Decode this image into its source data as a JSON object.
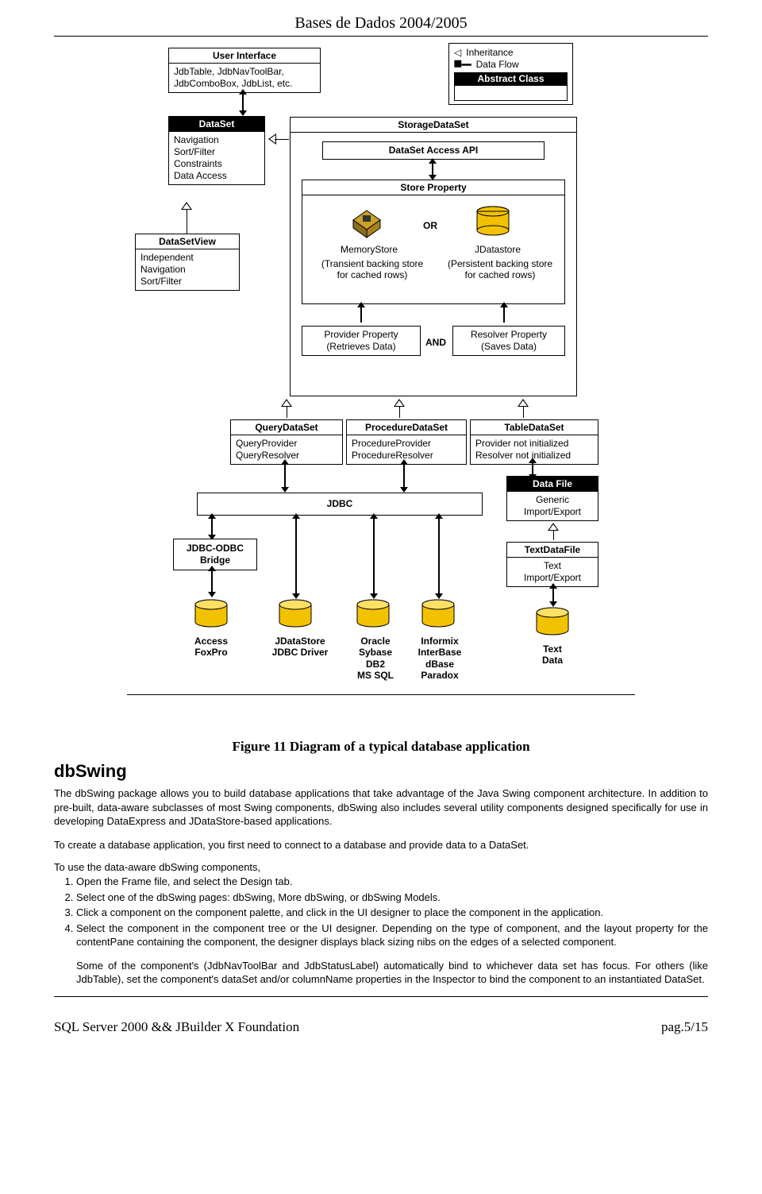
{
  "header": {
    "title": "Bases de Dados 2004/2005"
  },
  "diagram": {
    "legend": {
      "inheritance": "Inheritance",
      "dataflow": "Data Flow",
      "abstract": "Abstract Class"
    },
    "ui": {
      "title": "User Interface",
      "body": "JdbTable, JdbNavToolBar, JdbComboBox, JdbList, etc."
    },
    "dataset": {
      "title": "DataSet",
      "body": "Navigation\nSort/Filter\nConstraints\nData Access"
    },
    "datasetview": {
      "title": "DataSetView",
      "body": "Independent\nNavigation\nSort/Filter"
    },
    "storage": {
      "title": "StorageDataSet",
      "api": "DataSet Access API",
      "store_prop": "Store Property",
      "or": "OR",
      "mem_label": "MemoryStore",
      "mem_desc": "Transient backing store\nfor cached rows",
      "jds_label": "JDatastore",
      "jds_desc": "Persistent backing store\nfor cached rows",
      "provider": "Provider Property\n(Retrieves Data)",
      "and": "AND",
      "resolver": "Resolver Property\n(Saves Data)"
    },
    "query": {
      "title": "QueryDataSet",
      "body": "QueryProvider\nQueryResolver"
    },
    "proc": {
      "title": "ProcedureDataSet",
      "body": "ProcedureProvider\nProcedureResolver"
    },
    "table": {
      "title": "TableDataSet",
      "body": "Provider not initialized\nResolver not initialized"
    },
    "datafile": {
      "title": "Data File",
      "body": "Generic\nImport/Export"
    },
    "jdbc": {
      "title": "JDBC"
    },
    "textdatafile": {
      "title": "TextDataFile",
      "body": "Text\nImport/Export"
    },
    "bridge": {
      "title": "JDBC-ODBC\nBridge"
    },
    "sources": {
      "s1": "Access\nFoxPro",
      "s2": "JDataStore\nJDBC Driver",
      "s3": "Oracle\nSybase\nDB2\nMS SQL",
      "s4": "Informix\nInterBase\ndBase\nParadox",
      "s5": "Text\nData"
    }
  },
  "caption": "Figure 11 Diagram of a typical database application",
  "section": {
    "heading": "dbSwing",
    "p1": "The dbSwing package allows you to build database applications that take advantage of the Java Swing component architecture. In addition to pre-built, data-aware subclasses of most Swing components, dbSwing also includes several utility components designed specifically for use in developing DataExpress and JDataStore-based applications.",
    "p2": "To create a database application, you first need to connect to a database and provide data to a DataSet.",
    "p3_lead": "To use the data-aware dbSwing components,",
    "steps": [
      "Open the Frame file, and select the Design tab.",
      "Select one of the dbSwing pages: dbSwing, More dbSwing, or dbSwing Models.",
      "Click a component on the component palette, and click in the UI designer to place the component in the application.",
      "Select the component in the component tree or the UI designer. Depending on the type of component, and the layout property for the contentPane containing the component, the designer displays black sizing nibs on the edges of a selected component."
    ],
    "p4": "Some of the component's (JdbNavToolBar and JdbStatusLabel) automatically bind to whichever data set has focus. For others (like JdbTable), set the component's dataSet and/or columnName properties in the Inspector to bind the component to an instantiated DataSet."
  },
  "footer": {
    "left": "SQL Server 2000 && JBuilder X Foundation",
    "right": "pag.5/15"
  }
}
